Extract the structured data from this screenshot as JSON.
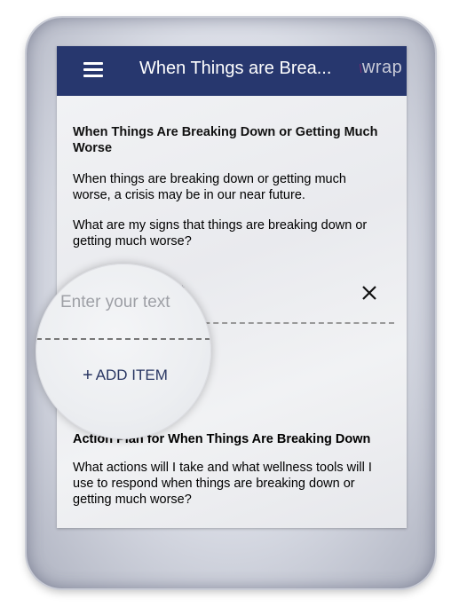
{
  "appbar": {
    "title": "When Things are Brea...",
    "logo_mark": "\\",
    "logo_text": "wrap"
  },
  "section1": {
    "title": "When Things Are Breaking Down or Getting Much Worse",
    "description": "When things are breaking down or getting much worse, a crisis may be in our near future.",
    "question": "What are my signs that things are breaking down or getting much worse?"
  },
  "input": {
    "placeholder": "Enter your text",
    "ghost_text": "xt"
  },
  "add_item": {
    "plus": "+",
    "label": "ADD ITEM"
  },
  "section2": {
    "title": "Action Plan for When Things Are Breaking Down",
    "question": "What actions will I take and what wellness tools will I use to respond when things are breaking down or getting much worse?"
  },
  "colors": {
    "appbar": "#27376e",
    "accent": "#2a3763",
    "placeholder": "#9ea0a6"
  }
}
